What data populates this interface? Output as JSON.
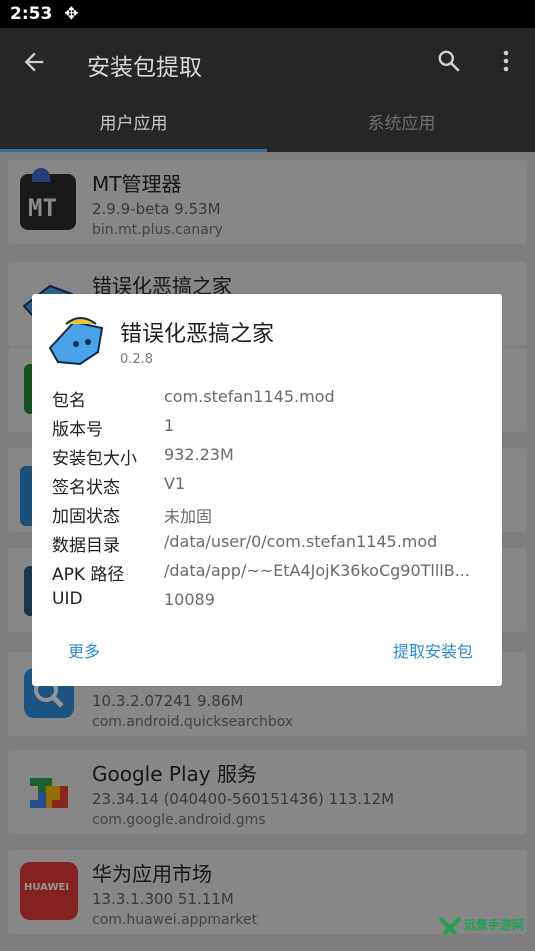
{
  "status_bar": {
    "time": "2:53"
  },
  "toolbar": {
    "title": "安装包提取"
  },
  "tabs": [
    {
      "label": "用户应用",
      "active": true
    },
    {
      "label": "系统应用",
      "active": false
    }
  ],
  "apps": [
    {
      "name": "MT管理器",
      "meta": "2.9.9-beta   9.53M",
      "package": "bin.mt.plus.canary"
    },
    {
      "name": "错误化恶搞之家",
      "meta": "",
      "package": ""
    },
    {
      "name": "",
      "meta": "10.3.2.07241   9.86M",
      "package": "com.android.quicksearchbox"
    },
    {
      "name": "Google Play 服务",
      "meta": "23.34.14 (040400-560151436)   113.12M",
      "package": "com.google.android.gms"
    },
    {
      "name": "华为应用市场",
      "meta": "13.3.1.300   51.11M",
      "package": "com.huawei.appmarket"
    }
  ],
  "dialog": {
    "app_name": "错误化恶搞之家",
    "version": "0.2.8",
    "rows": [
      {
        "label": "包名",
        "value": "com.stefan1145.mod"
      },
      {
        "label": "版本号",
        "value": "1"
      },
      {
        "label": "安装包大小",
        "value": "932.23M"
      },
      {
        "label": "签名状态",
        "value": "V1"
      },
      {
        "label": "加固状态",
        "value": "未加固"
      },
      {
        "label": "数据目录",
        "value": "/data/user/0/com.stefan1145.mod"
      },
      {
        "label": "APK 路径",
        "value": "/data/app/~~EtA4JojK36koCg90TlllB..."
      },
      {
        "label": "UID",
        "value": "10089"
      }
    ],
    "more_button": "更多",
    "extract_button": "提取安装包"
  },
  "watermark": {
    "text": "远景手游网"
  },
  "colors": {
    "accent": "#2c8ad6",
    "toolbar_bg": "#262626",
    "tab_indicator": "#2e6fa8"
  }
}
